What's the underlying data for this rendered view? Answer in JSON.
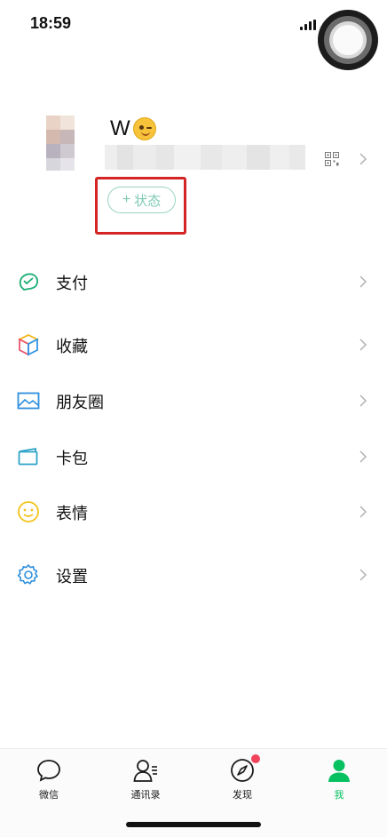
{
  "status_bar": {
    "time": "18:59"
  },
  "profile": {
    "name": "W",
    "name_emoji_icon": "winking-face-icon",
    "status_button": {
      "plus": "+",
      "label": "状态"
    },
    "qr_icon": "qr-code-icon"
  },
  "menu": {
    "items": [
      {
        "label": "支付",
        "icon": "pay-icon"
      },
      {
        "label": "收藏",
        "icon": "favorites-cube-icon"
      },
      {
        "label": "朋友圈",
        "icon": "moments-image-icon"
      },
      {
        "label": "卡包",
        "icon": "card-wallet-icon"
      },
      {
        "label": "表情",
        "icon": "sticker-smile-icon"
      },
      {
        "label": "设置",
        "icon": "settings-gear-icon"
      }
    ]
  },
  "tabbar": {
    "tabs": [
      {
        "label": "微信",
        "icon": "chat-bubble-icon"
      },
      {
        "label": "通讯录",
        "icon": "contacts-icon"
      },
      {
        "label": "发现",
        "icon": "compass-icon",
        "badge": "red-dot"
      },
      {
        "label": "我",
        "icon": "person-icon",
        "active": true
      }
    ]
  },
  "colors": {
    "accent_green": "#07c160",
    "highlight_red": "#d42424",
    "status_teal": "#7ec9b4",
    "badge_red": "#f0435c"
  }
}
